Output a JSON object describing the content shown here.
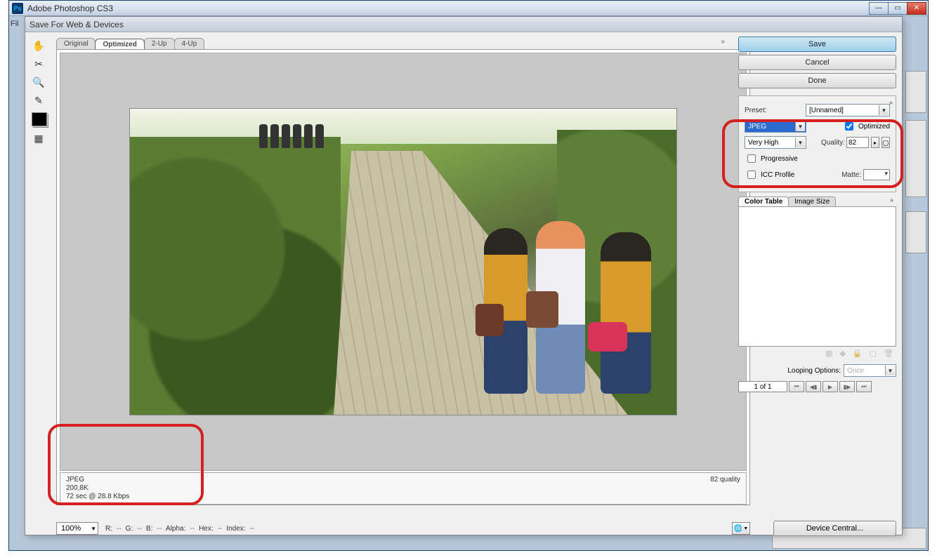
{
  "window": {
    "title": "Adobe Photoshop CS3",
    "menu_hint": "Fil"
  },
  "dialog": {
    "title": "Save For Web & Devices"
  },
  "preview_tabs": [
    "Original",
    "Optimized",
    "2-Up",
    "4-Up"
  ],
  "active_preview_tab": "Optimized",
  "preview_info": {
    "format": "JPEG",
    "size": "200,8K",
    "time": "72 sec @ 28.8 Kbps",
    "quality_label": "82 quality"
  },
  "status": {
    "zoom": "100%",
    "r": "R:",
    "r_v": "--",
    "g": "G:",
    "g_v": "--",
    "b": "B:",
    "b_v": "--",
    "alpha": "Alpha:",
    "alpha_v": "--",
    "hex": "Hex:",
    "hex_v": "--",
    "index": "Index:",
    "index_v": "--"
  },
  "actions": {
    "save": "Save",
    "cancel": "Cancel",
    "done": "Done"
  },
  "settings": {
    "preset_label": "Preset:",
    "preset_value": "[Unnamed]",
    "format": "JPEG",
    "quality_preset": "Very High",
    "optimized_label": "Optimized",
    "optimized_checked": true,
    "quality_label": "Quality:",
    "quality_value": "82",
    "progressive_label": "Progressive",
    "icc_label": "ICC Profile",
    "matte_label": "Matte:"
  },
  "color_table": {
    "tabs": [
      "Color Table",
      "Image Size"
    ],
    "active": "Color Table"
  },
  "looping": {
    "label": "Looping Options:",
    "value": "Once"
  },
  "playback": {
    "frame": "1 of 1"
  },
  "device_central": "Device Central..."
}
